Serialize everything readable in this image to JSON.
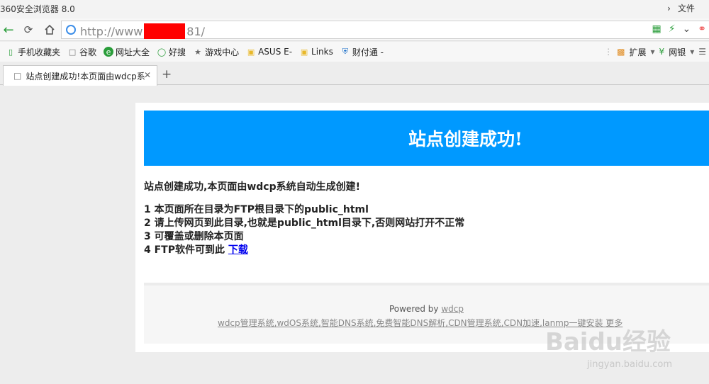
{
  "window": {
    "title": "360安全浏览器 8.0",
    "menu_label": "文件"
  },
  "navigation": {
    "url_prefix": "http://www",
    "url_suffix": "81/"
  },
  "bookmarks": [
    {
      "label": "手机收藏夹",
      "icon": "phone-icon"
    },
    {
      "label": "谷歌",
      "icon": "page-icon"
    },
    {
      "label": "网址大全",
      "icon": "web-icon"
    },
    {
      "label": "好搜",
      "icon": "search-icon"
    },
    {
      "label": "游戏中心",
      "icon": "gamepad-icon"
    },
    {
      "label": "ASUS E-",
      "icon": "folder-icon"
    },
    {
      "label": "Links",
      "icon": "folder-icon"
    },
    {
      "label": "财付通 -",
      "icon": "shield-icon"
    }
  ],
  "bookmarks_right": {
    "extensions": "扩展",
    "bank": "网银"
  },
  "tab": {
    "title": "站点创建成功!本页面由wdcp系"
  },
  "page": {
    "heading": "站点创建成功!",
    "intro": "站点创建成功,本页面由wdcp系统自动生成创建!",
    "step1": "1 本页面所在目录为FTP根目录下的public_html",
    "step2": "2 请上传网页到此目录,也就是public_html目录下,否则网站打开不正常",
    "step3": "3 可覆盖或删除本页面",
    "step4": "4 FTP软件可到此",
    "download_link": "下载",
    "powered_text": "Powered by",
    "powered_link": "wdcp",
    "footer_links": "wdcp管理系统,wdOS系统,智能DNS系统,免费智能DNS解析,CDN管理系统,CDN加速,lanmp一键安装 更多"
  },
  "watermark": {
    "main": "Baidu经验",
    "sub": "jingyan.baidu.com"
  },
  "colors": {
    "banner": "#0099ff",
    "back_arrow": "#2a9d3a",
    "redaction": "#ff0000"
  }
}
